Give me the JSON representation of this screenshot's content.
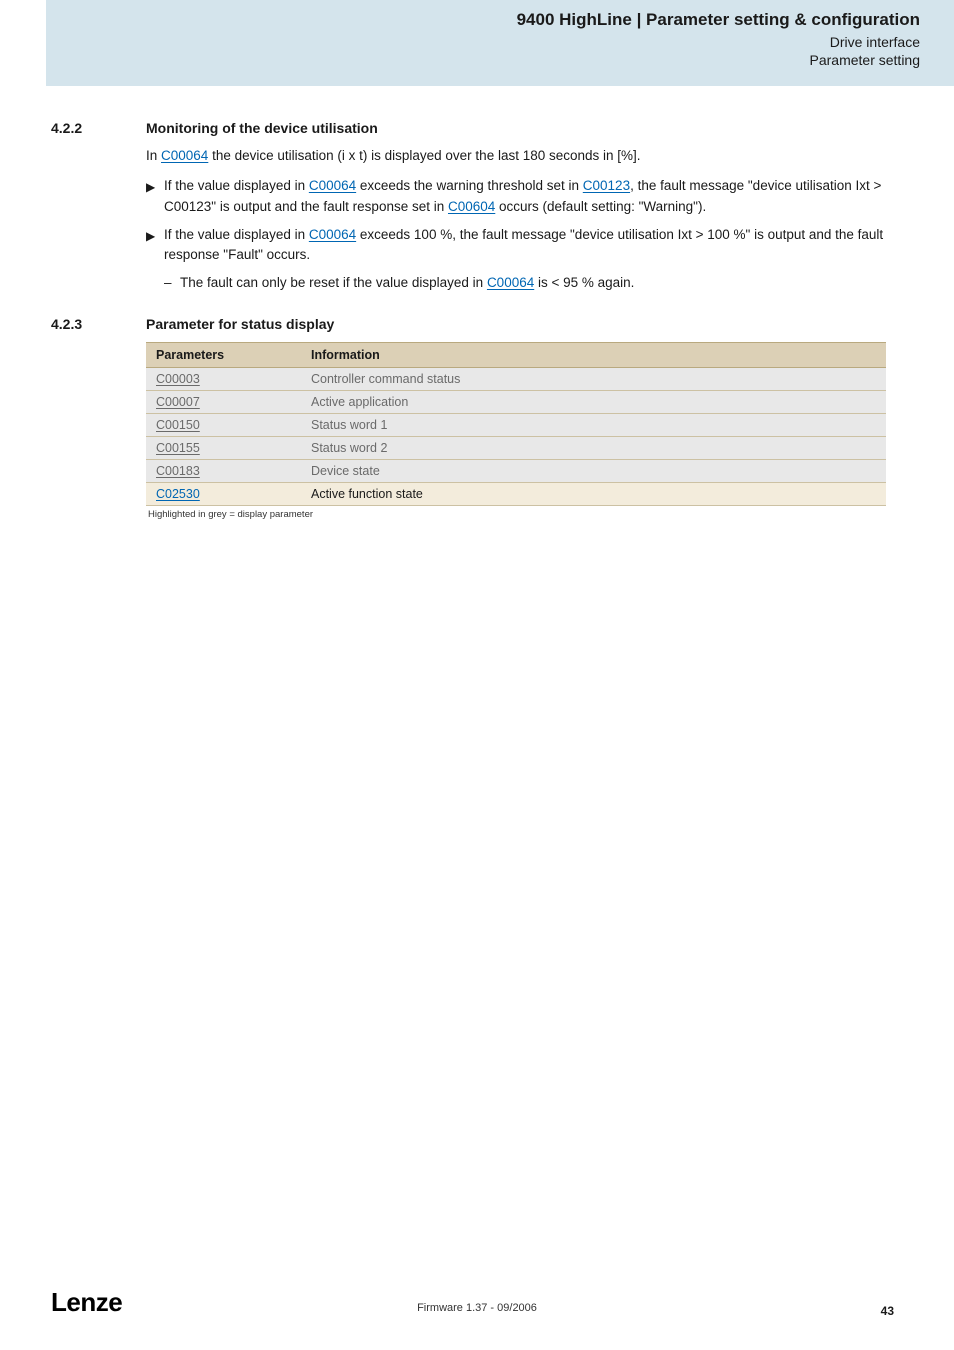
{
  "header": {
    "title": "9400 HighLine | Parameter setting & configuration",
    "sub1": "Drive interface",
    "sub2": "Parameter setting"
  },
  "section422": {
    "num": "4.2.2",
    "title": "Monitoring of the device utilisation",
    "intro_a": "In ",
    "intro_link": "C00064",
    "intro_b": " the  device utilisation (i x t) is displayed over the last 180 seconds in [%].",
    "b1_a": "If the value displayed in ",
    "b1_l1": "C00064",
    "b1_b": " exceeds the warning threshold set in ",
    "b1_l2": "C00123",
    "b1_c": ", the fault message \"device utilisation Ixt > C00123\" is output and the fault response set in ",
    "b1_l3": "C00604",
    "b1_d": " occurs (default setting: \"Warning\").",
    "b2_a": "If the value displayed in ",
    "b2_l1": "C00064",
    "b2_b": " exceeds 100 %, the fault message \"device utilisation Ixt > 100 %\" is output and the fault response \"Fault\" occurs.",
    "sub_a": "The fault can only be reset if the value displayed in ",
    "sub_l": "C00064",
    "sub_b": " is < 95 % again."
  },
  "section423": {
    "num": "4.2.3",
    "title": "Parameter for status display",
    "h1": "Parameters",
    "h2": "Information",
    "rows": [
      {
        "p": "C00003",
        "i": "Controller command status"
      },
      {
        "p": "C00007",
        "i": "Active application"
      },
      {
        "p": "C00150",
        "i": "Status word 1"
      },
      {
        "p": "C00155",
        "i": "Status word 2"
      },
      {
        "p": "C00183",
        "i": "Device state"
      },
      {
        "p": "C02530",
        "i": "Active function state"
      }
    ],
    "footnote": "Highlighted in grey = display parameter"
  },
  "footer": {
    "logo": "Lenze",
    "center": "Firmware 1.37 - 09/2006",
    "page": "43"
  }
}
